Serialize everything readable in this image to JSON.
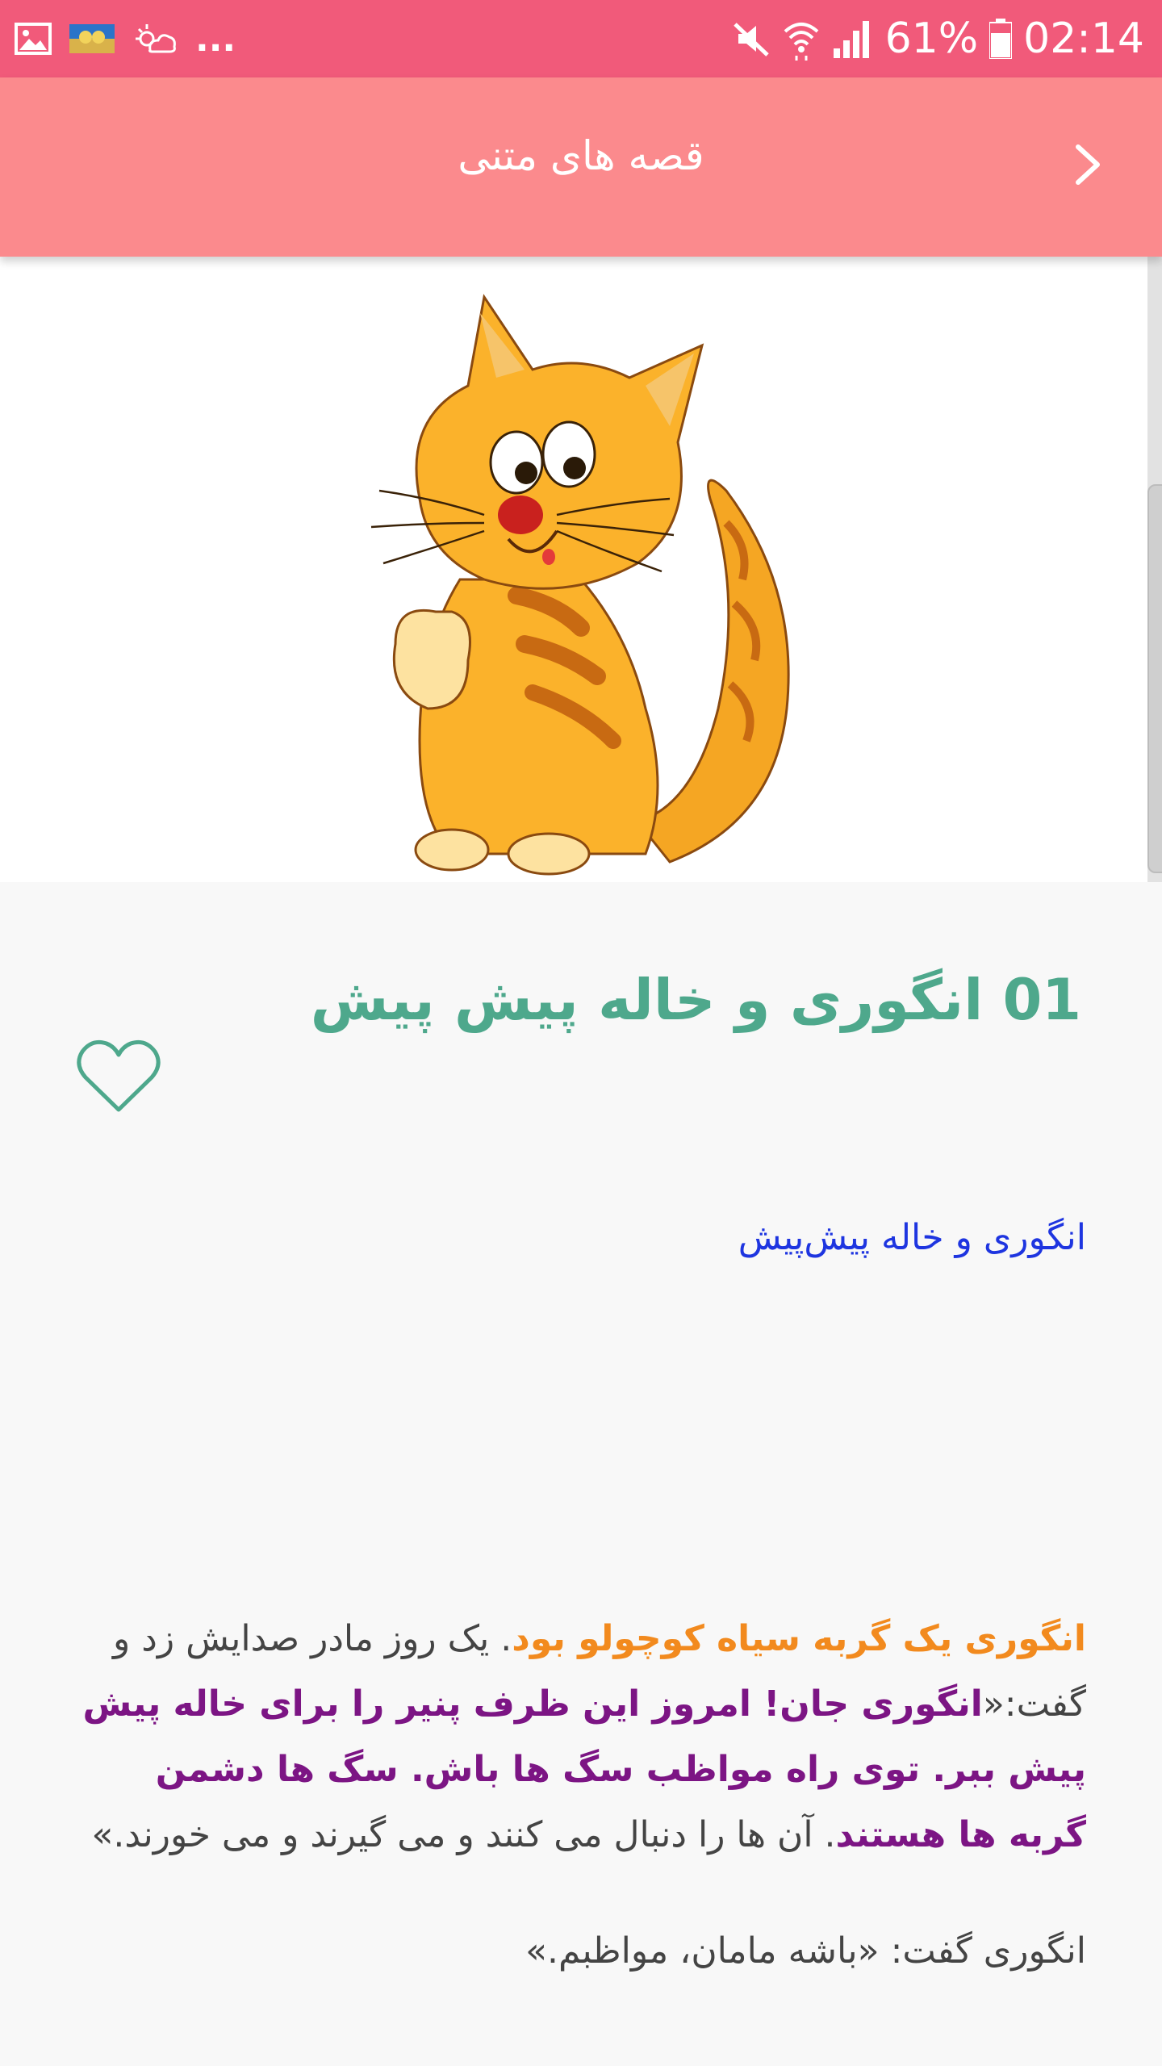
{
  "status_bar": {
    "left_icons": [
      "gallery-icon",
      "thumbnail-icon",
      "weather-icon"
    ],
    "more_indicator": "...",
    "right_icons": [
      "mute-icon",
      "wifi-icon",
      "signal-icon"
    ],
    "battery": "61%",
    "time": "02:14"
  },
  "app_bar": {
    "title": "قصه های متنی",
    "back_icon": "chevron-right-icon"
  },
  "story": {
    "title": "01 انگوری و خاله پیش پیش",
    "favorite_icon": "heart-outline-icon",
    "subheading": "انگوری و خاله پیش‌پیش",
    "paragraph1": {
      "orange_intro": "انگوری یک گربه سیاه کوچولو بود",
      "text_a": ". یک روز مادر صدایش زد و گفت:«",
      "purple_quote": "انگوری جان! امروز این ظرف پنیر را برای خاله پیش پیش ببر. توی راه مواظب سگ ها باش. سگ ها دشمن گربه ها هستند",
      "text_b": ". آن ها را دنبال می کنند و می گیرند و می خورند.»"
    },
    "paragraph2": "انگوری گفت: «باشه مامان، مواظبم.»"
  },
  "colors": {
    "status_bar": "#f15a7a",
    "app_bar": "#fb8a8d",
    "title": "#4ea88c",
    "subheading": "#1e35e0",
    "highlight_orange": "#f28a1e",
    "highlight_purple": "#7c1584"
  }
}
